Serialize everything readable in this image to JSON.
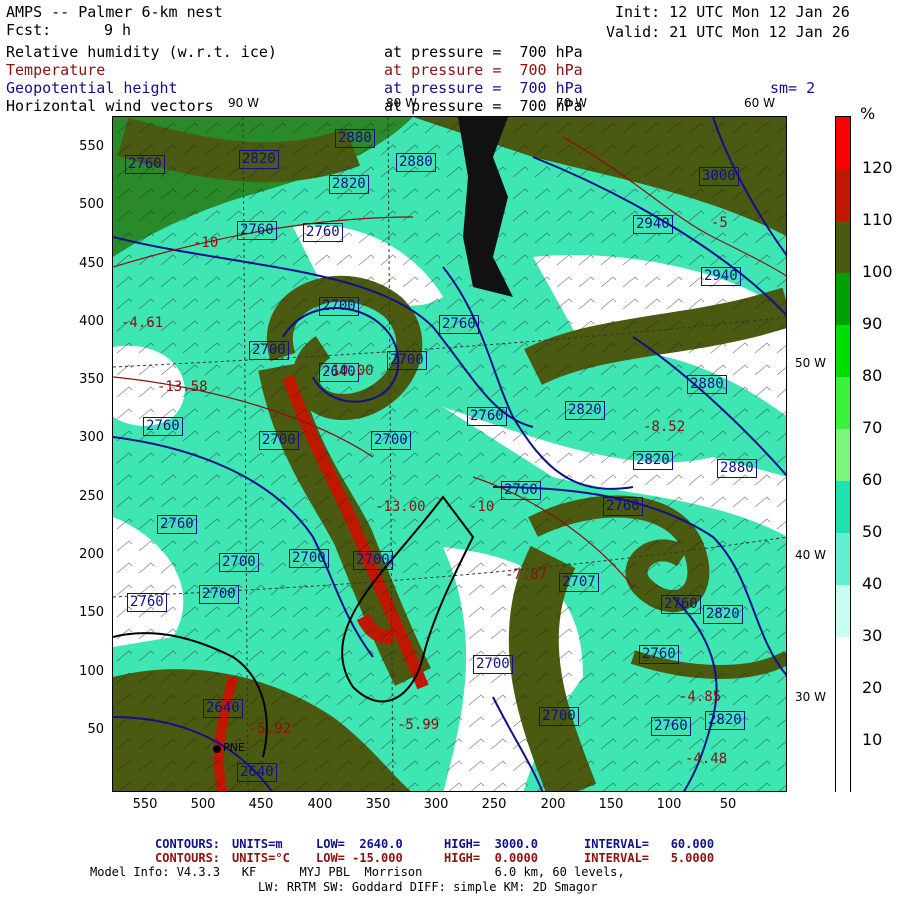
{
  "header": {
    "model": "AMPS -- Palmer 6-km nest",
    "fcst_label": "Fcst:",
    "fcst_value": "9 h",
    "init": "Init: 12 UTC Mon 12 Jan 26",
    "valid": "Valid: 21 UTC Mon 12 Jan 26"
  },
  "fields": [
    {
      "name": "Relative humidity (w.r.t. ice)",
      "level": "at pressure =  700 hPa",
      "color": "#000000"
    },
    {
      "name": "Temperature",
      "level": "at pressure =  700 hPa",
      "color": "#8b1010"
    },
    {
      "name": "Geopotential height",
      "level": "at pressure =  700 hPa",
      "color": "#10108b"
    },
    {
      "name": "Horizontal wind vectors",
      "level": "at pressure =  700 hPa",
      "color": "#000000"
    }
  ],
  "smoothing": "sm= 2",
  "colorbar": {
    "unit": "%",
    "labels": [
      "120",
      "110",
      "100",
      "90",
      "80",
      "70",
      "60",
      "50",
      "40",
      "30",
      "20",
      "10"
    ],
    "colors": [
      "#ff0000",
      "#c01800",
      "#4a5a10",
      "#00a000",
      "#00dd00",
      "#3af23a",
      "#7cf57c",
      "#20e0b0",
      "#60f0d0",
      "#c8fff0",
      "#ffffff",
      "#ffffff",
      "#ffffff"
    ]
  },
  "axes": {
    "y_ticks": [
      "550",
      "500",
      "450",
      "400",
      "350",
      "300",
      "250",
      "200",
      "150",
      "100",
      "50"
    ],
    "x_ticks": [
      "550",
      "500",
      "450",
      "400",
      "350",
      "300",
      "250",
      "200",
      "150",
      "100",
      "50"
    ]
  },
  "longitudes": {
    "top": [
      "90 W",
      "80 W",
      "70 W",
      "60 W"
    ],
    "right": [
      "50 W",
      "40 W",
      "30 W"
    ]
  },
  "height_labels": [
    "2760",
    "2820",
    "2880",
    "2880",
    "2820",
    "3000",
    "2760",
    "2760",
    "2940",
    "2940",
    "2700",
    "2760",
    "2700",
    "2640",
    "2700",
    "2760",
    "2820",
    "2880",
    "2760",
    "2820",
    "2880",
    "2700",
    "2700",
    "2760",
    "2760",
    "2760",
    "2700",
    "2700",
    "2700",
    "2760",
    "2707",
    "2700",
    "2760",
    "2700",
    "2760",
    "2820",
    "2640",
    "2640",
    "2760",
    "2820",
    "2700"
  ],
  "temp_labels": [
    "-10",
    "-5",
    "-4.61",
    "-13.58",
    "-10.00",
    "-8.52",
    "-13.00",
    "-10",
    "-7.87",
    "-4.85",
    "-4.48",
    "-5.92",
    "-5.99"
  ],
  "station": "PNE",
  "footer": {
    "c1_label": "CONTOURS:",
    "c1_units": "UNITS=m",
    "c1_low": "LOW=  2640.0",
    "c1_high": "HIGH=  3000.0",
    "c1_int": "INTERVAL=   60.000",
    "c2_label": "CONTOURS:",
    "c2_units": "UNITS=°C",
    "c2_low": "LOW= -15.000",
    "c2_high": "HIGH=  0.0000",
    "c2_int": "INTERVAL=   5.0000",
    "model_info": "Model Info: V4.3.3   KF      MYJ PBL  Morrison          6.0 km, 60 levels,",
    "phys": "LW: RRTM SW: Goddard DIFF: simple KM: 2D Smagor"
  }
}
